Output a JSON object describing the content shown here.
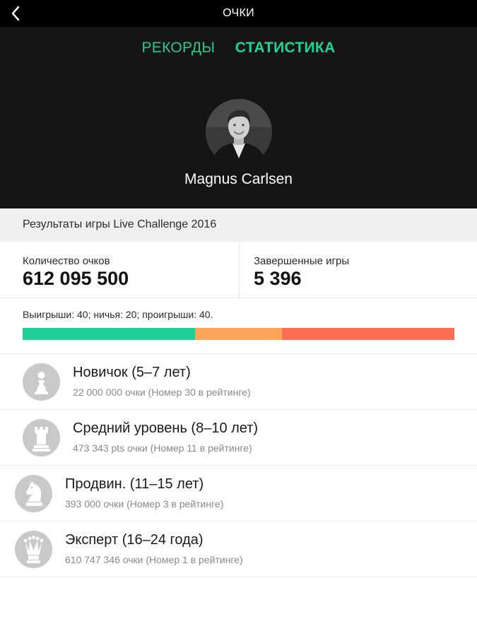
{
  "header": {
    "title": "ОЧКИ",
    "back_icon": "chevron-left-icon"
  },
  "tabs": [
    {
      "label": "РЕКОРДЫ",
      "active": false,
      "color": "#27c98e"
    },
    {
      "label": "СТАТИСТИКА",
      "active": true,
      "color": "#1fd795"
    }
  ],
  "profile": {
    "name": "Magnus Carlsen",
    "avatar": "player-avatar"
  },
  "section": {
    "title": "Результаты игры Live Challenge 2016"
  },
  "stats": {
    "points_label": "Количество очков",
    "points_value": "612 095 500",
    "games_label": "Завершенные игры",
    "games_value": "5 396"
  },
  "results": {
    "text": "Выигрыши: 40; ничья: 20; проигрыши: 40.",
    "wins": 40,
    "draws": 20,
    "losses": 40,
    "colors": {
      "wins": "#1ccf95",
      "draws": "#fba55a",
      "losses": "#fc6d53"
    }
  },
  "levels": [
    {
      "title": "Новичок (5–7 лет)",
      "subtitle": "22 000 000 очки (Номер 30 в рейтинге)",
      "icon": "pawn-icon"
    },
    {
      "title": "Средний уровень (8–10 лет)",
      "subtitle": "473 343 pts очки (Номер 11 в рейтинге)",
      "icon": "rook-icon"
    },
    {
      "title": "Продвин. (11–15 лет)",
      "subtitle": "393 000 очки (Номер 3 в рейтинге)",
      "icon": "knight-icon"
    },
    {
      "title": "Эксперт (16–24 года)",
      "subtitle": "610 747 346 очки (Номер 1 в рейтинге)",
      "icon": "queen-icon"
    }
  ]
}
